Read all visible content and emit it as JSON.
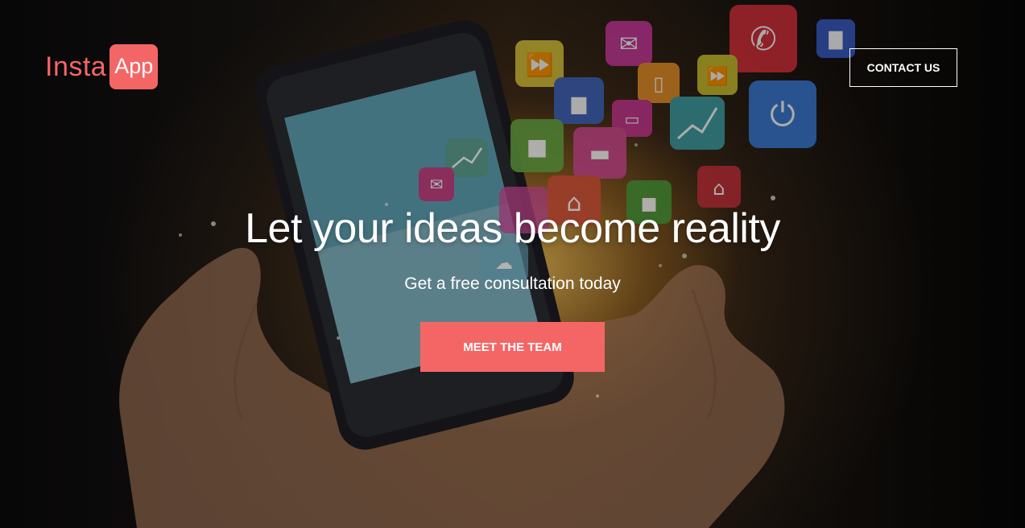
{
  "brand": {
    "name_part1": "Insta",
    "name_part2": "App"
  },
  "header": {
    "contact_label": "CONTACT US"
  },
  "hero": {
    "headline": "Let your ideas become reality",
    "subheadline": "Get a free consultation today",
    "cta_label": "MEET THE TEAM"
  },
  "icons": [
    "fast-forward-icon",
    "mail-icon",
    "phone-icon",
    "bar-chart-icon",
    "bar-chart-icon",
    "mobile-icon",
    "monitor-icon",
    "fast-forward-icon",
    "power-icon",
    "video-camera-icon",
    "briefcase-icon",
    "line-chart-icon",
    "line-chart-icon",
    "home-icon",
    "mail-icon",
    "people-icon",
    "home-icon",
    "video-camera-icon",
    "cloud-icon"
  ],
  "colors": {
    "accent": "#f46666",
    "text": "#ffffff"
  }
}
